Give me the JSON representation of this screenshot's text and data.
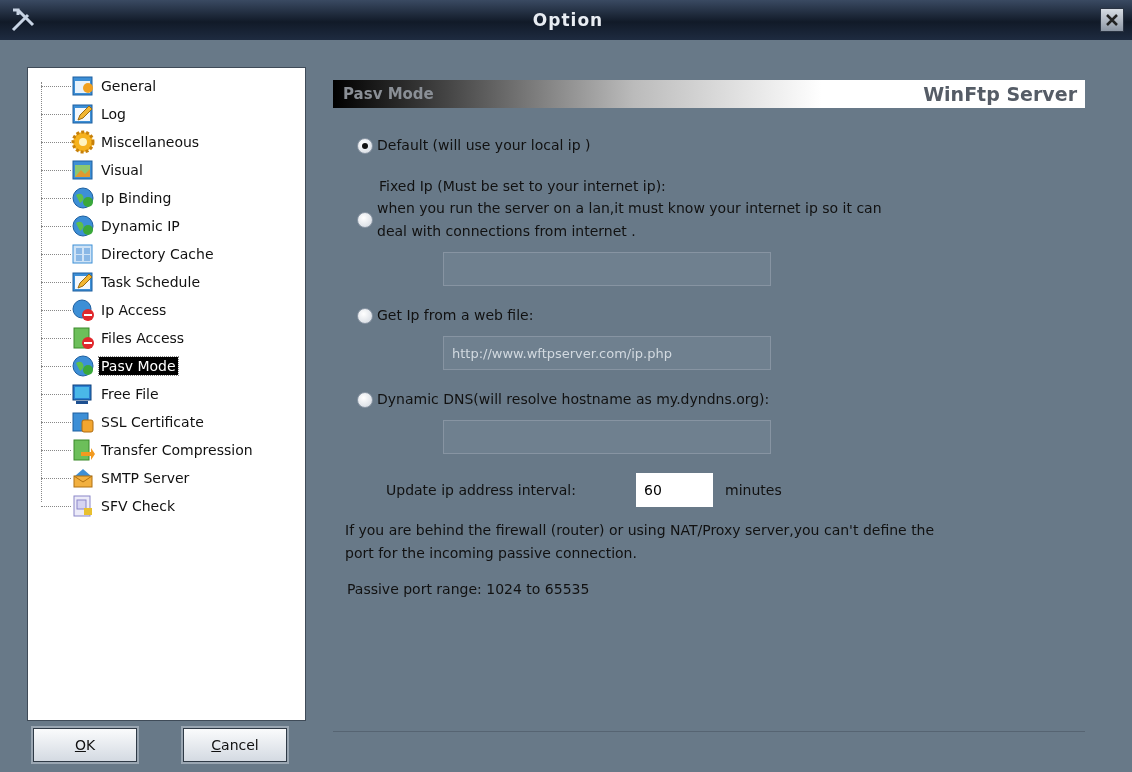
{
  "window": {
    "title": "Option"
  },
  "tree": {
    "items": [
      {
        "label": "General",
        "kind": "window",
        "selected": false
      },
      {
        "label": "Log",
        "kind": "pencil",
        "selected": false
      },
      {
        "label": "Miscellaneous",
        "kind": "gear",
        "selected": false
      },
      {
        "label": "Visual",
        "kind": "picture",
        "selected": false
      },
      {
        "label": "Ip Binding",
        "kind": "globe",
        "selected": false
      },
      {
        "label": "Dynamic IP",
        "kind": "globe",
        "selected": false
      },
      {
        "label": "Directory Cache",
        "kind": "grid",
        "selected": false
      },
      {
        "label": "Task Schedule",
        "kind": "pencil",
        "selected": false
      },
      {
        "label": "Ip Access",
        "kind": "globe-block",
        "selected": false
      },
      {
        "label": "Files Access",
        "kind": "file-block",
        "selected": false
      },
      {
        "label": "Pasv Mode",
        "kind": "globe",
        "selected": true
      },
      {
        "label": "Free File",
        "kind": "monitor",
        "selected": false
      },
      {
        "label": "SSL Certificate",
        "kind": "certificate",
        "selected": false
      },
      {
        "label": "Transfer Compression",
        "kind": "file-arrow",
        "selected": false
      },
      {
        "label": "SMTP Server",
        "kind": "envelope",
        "selected": false
      },
      {
        "label": "SFV Check",
        "kind": "files",
        "selected": false
      }
    ]
  },
  "buttons": [
    {
      "label": "OK"
    },
    {
      "label": "Cancel"
    }
  ],
  "header": {
    "title": "Pasv Mode",
    "brand": "WinFtp Server"
  },
  "options": [
    {
      "label": "Default (will use your local ip )",
      "selected": true
    },
    {
      "caption": "Fixed Ip (Must be set to your internet ip):",
      "label": "when you run the server on a lan,it must know your internet ip so it  can\ndeal  with connections from internet .",
      "selected": false,
      "field": {
        "disabled": true
      }
    },
    {
      "label": "Get Ip from a web file:",
      "selected": false,
      "field": {
        "value": "http://www.wftpserver.com/ip.php",
        "disabled": true
      }
    },
    {
      "label": "Dynamic DNS(will resolve hostname as my.dyndns.org):",
      "selected": false,
      "field": {
        "disabled": true
      }
    }
  ],
  "interval": {
    "label": "Update ip address interval:",
    "value": "60",
    "unit": "minutes"
  },
  "note": "If you are behind the firewall (router) or using  NAT/Proxy server,you can't define the\nport for the incoming passive connection.",
  "port_range": "Passive port range:  1024  to  65535"
}
